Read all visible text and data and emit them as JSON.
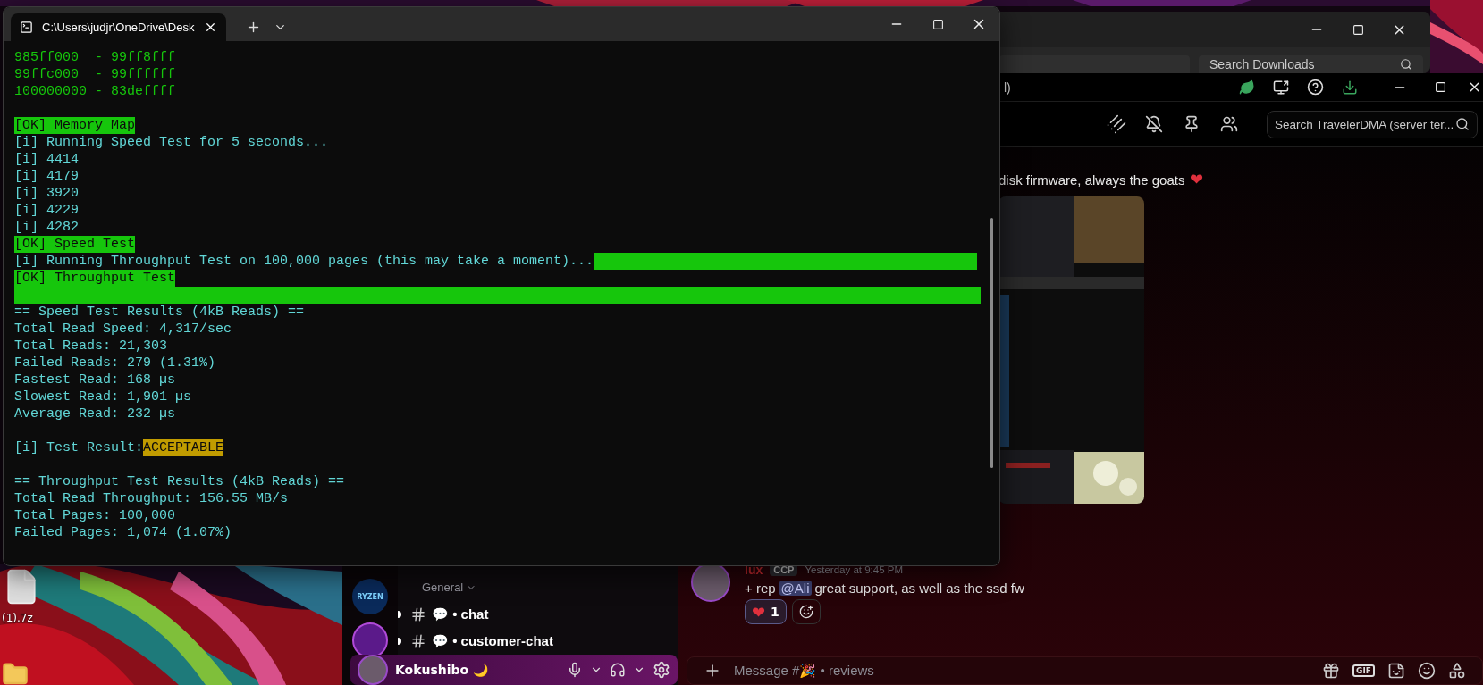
{
  "desktop": {
    "labels": [
      {
        "text": "(1).7z"
      }
    ]
  },
  "terminal": {
    "tab_title": "C:\\Users\\judjr\\OneDrive\\Desk",
    "lines": [
      {
        "kind": "address",
        "text": "985ff000  - 99ff8fff"
      },
      {
        "kind": "address",
        "text": "99ffc000  - 99ffffff"
      },
      {
        "kind": "address",
        "text": "100000000 - 83deffff"
      },
      {
        "kind": "gap"
      },
      {
        "kind": "ok",
        "text": "[OK] Memory Map"
      },
      {
        "kind": "info",
        "text": "[i] Running Speed Test for 5 seconds..."
      },
      {
        "kind": "info",
        "text": "[i] 4414"
      },
      {
        "kind": "info",
        "text": "[i] 4179"
      },
      {
        "kind": "info",
        "text": "[i] 3920"
      },
      {
        "kind": "info",
        "text": "[i] 4229"
      },
      {
        "kind": "info",
        "text": "[i] 4282"
      },
      {
        "kind": "ok",
        "text": "[OK] Speed Test"
      },
      {
        "kind": "info",
        "text": "[i] Running Throughput Test on 100,000 pages (this may take a moment)...",
        "level": 1
      },
      {
        "kind": "ok",
        "text": "[OK] Throughput Test"
      },
      {
        "kind": "bar",
        "level": 1
      },
      {
        "kind": "info",
        "text": "== Speed Test Results (4kB Reads) =="
      },
      {
        "kind": "info",
        "text": "Total Read Speed: 4,317/sec"
      },
      {
        "kind": "info",
        "text": "Total Reads: 21,303"
      },
      {
        "kind": "info",
        "text": "Failed Reads: 279 (1.31%)"
      },
      {
        "kind": "info",
        "text": "Fastest Read: 168 µs"
      },
      {
        "kind": "info",
        "text": "Slowest Read: 1,901 µs"
      },
      {
        "kind": "info",
        "text": "Average Read: 232 µs"
      },
      {
        "kind": "gap"
      },
      {
        "kind": "result",
        "text": "[i] Test Result:",
        "badge": "ACCEPTABLE"
      },
      {
        "kind": "gap"
      },
      {
        "kind": "info",
        "text": "== Throughput Test Results (4kB Reads) =="
      },
      {
        "kind": "info",
        "text": "Total Read Throughput: 156.55 MB/s"
      },
      {
        "kind": "info",
        "text": "Total Pages: 100,000"
      },
      {
        "kind": "info",
        "text": "Failed Pages: 1,074 (1.07%)"
      }
    ]
  },
  "downloads_window": {
    "search": {
      "placeholder": "Search Downloads"
    }
  },
  "discord": {
    "title_fragment": "l)",
    "search": {
      "placeholder": "Search TravelerDMA (server ter..."
    },
    "message_fragment": {
      "text": "disk firmware, always the goats",
      "emoji": "❤"
    },
    "server_icons": [
      {
        "kind": "logo",
        "label": "RYZEN"
      },
      {
        "kind": "avatar"
      }
    ],
    "channels": {
      "category": "General",
      "items": [
        {
          "name": "💬 • chat",
          "unread": true
        },
        {
          "name": "💬 • customer-chat",
          "unread": true
        }
      ]
    },
    "user": {
      "name": "Kokushibo 🌙"
    },
    "message": {
      "author": "lux",
      "tag": "CCP",
      "time": "Yesterday at 9:45 PM",
      "parts": [
        {
          "kind": "text",
          "text": "+ rep"
        },
        {
          "kind": "mention",
          "text": "@Ali"
        },
        {
          "kind": "text",
          "text": "great support, as well as the ssd fw"
        }
      ],
      "reactions": [
        {
          "emoji": "❤",
          "count": "1",
          "selected": true
        }
      ]
    },
    "composer": {
      "placeholder": "Message #🎉 • reviews",
      "gif_label": "GIF"
    }
  }
}
